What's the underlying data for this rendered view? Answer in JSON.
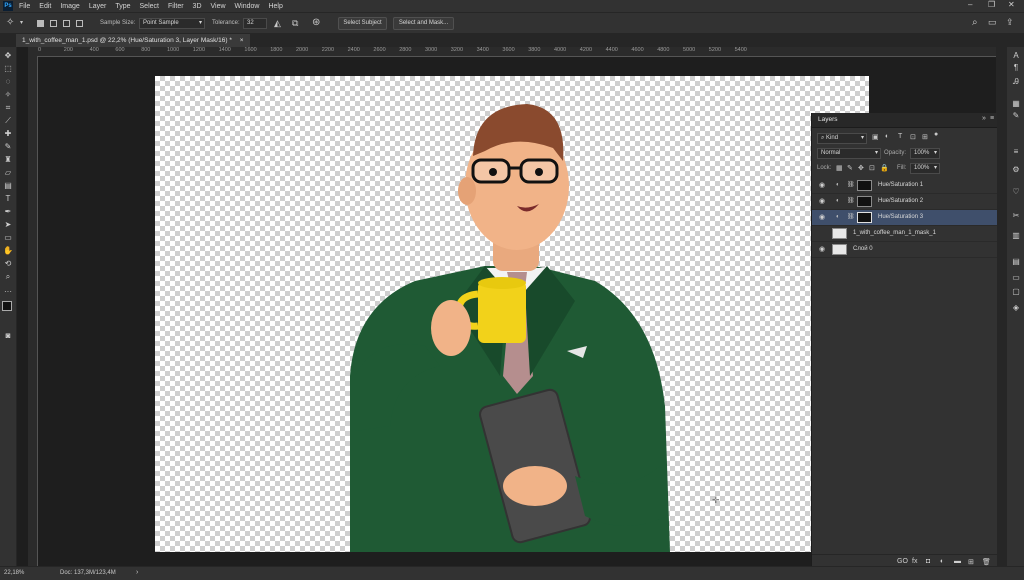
{
  "app": {
    "logo": "Ps"
  },
  "menu": [
    "File",
    "Edit",
    "Image",
    "Layer",
    "Type",
    "Select",
    "Filter",
    "3D",
    "View",
    "Window",
    "Help"
  ],
  "window_controls": {
    "minimize": "–",
    "maximize": "❐",
    "close": "✕"
  },
  "options": {
    "sample_size_label": "Sample Size:",
    "sample_size_value": "Point Sample",
    "tolerance_label": "Tolerance:",
    "tolerance_value": "32",
    "select_subject": "Select Subject",
    "select_and_mask": "Select and Mask..."
  },
  "tab": {
    "title": "1_with_coffee_man_1.psd @ 22,2% (Hue/Saturation 3, Layer Mask/16) *",
    "close": "×"
  },
  "ruler": {
    "ticks": [
      "0",
      "200",
      "400",
      "600",
      "800",
      "1000",
      "1200",
      "1400",
      "1600",
      "1800",
      "2000",
      "2200",
      "2400",
      "2600",
      "2800",
      "3000",
      "3200",
      "3400",
      "3600",
      "3800",
      "4000",
      "4200",
      "4400",
      "4600",
      "4800",
      "5000",
      "5200",
      "5400"
    ]
  },
  "layers_panel": {
    "title": "Layers",
    "filter_kind": "Kind",
    "blend_mode": "Normal",
    "opacity_label": "Opacity:",
    "opacity_value": "100%",
    "lock_label": "Lock:",
    "fill_label": "Fill:",
    "fill_value": "100%",
    "layers": [
      {
        "name": "Hue/Saturation 1",
        "visible": true,
        "selected": false
      },
      {
        "name": "Hue/Saturation 2",
        "visible": true,
        "selected": false
      },
      {
        "name": "Hue/Saturation 3",
        "visible": true,
        "selected": true
      },
      {
        "name": "1_with_coffee_man_1_mask_1",
        "visible": false,
        "selected": false
      },
      {
        "name": "Слой 0",
        "visible": true,
        "selected": false
      }
    ],
    "footer": [
      "GO",
      "fx",
      "◘",
      "◐",
      "▬",
      "⊞",
      "🗑"
    ]
  },
  "status": {
    "zoom": "22,18%",
    "doc": "Doc: 137,3M/123,4M",
    "arrow": "›"
  },
  "colors": {
    "selected_layer": "#3f4f6b",
    "panel_bg": "#323232",
    "jacket": "#1f5a34",
    "mug": "#f2d21a"
  }
}
